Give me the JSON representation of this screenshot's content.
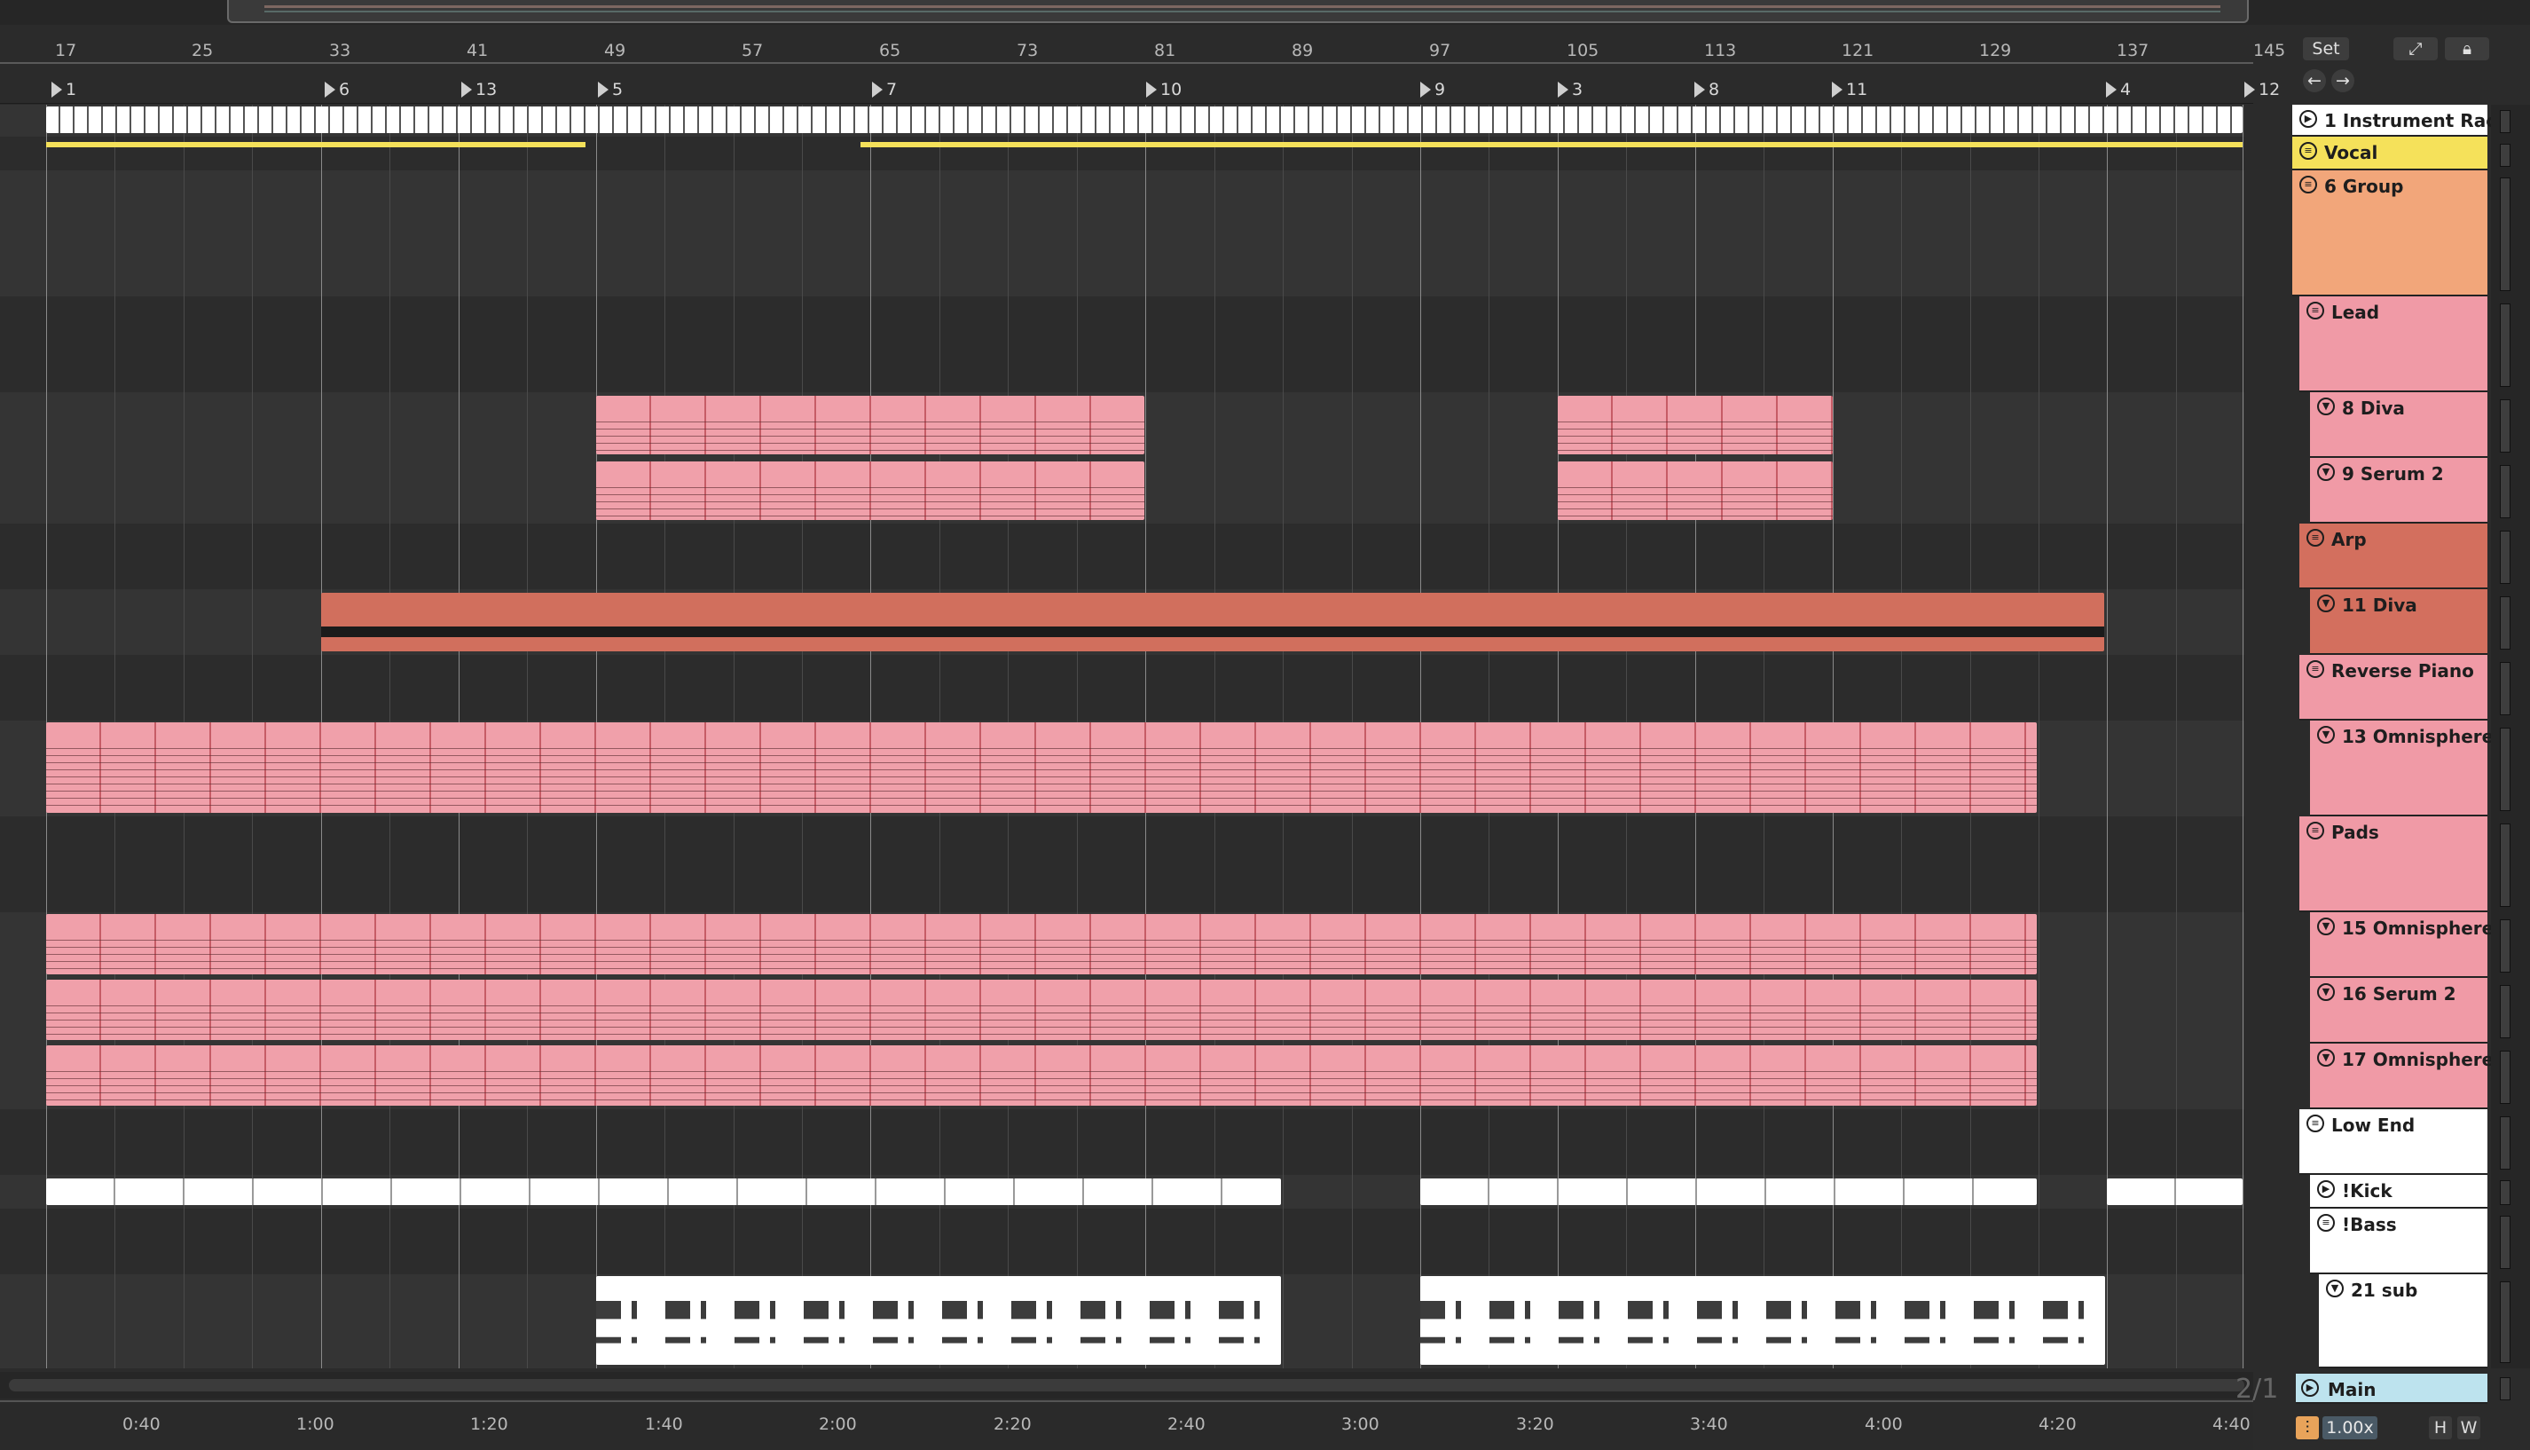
{
  "bar_ruler": [
    "17",
    "25",
    "33",
    "41",
    "49",
    "57",
    "65",
    "73",
    "81",
    "89",
    "97",
    "105",
    "113",
    "121",
    "129",
    "137",
    "145"
  ],
  "locators": [
    "1",
    "6",
    "13",
    "5",
    "7",
    "10",
    "9",
    "3",
    "8",
    "11",
    "4",
    "12"
  ],
  "time_ruler": [
    "0:40",
    "1:00",
    "1:20",
    "1:40",
    "2:00",
    "2:20",
    "2:40",
    "3:00",
    "3:20",
    "3:40",
    "4:00",
    "4:20",
    "4:40"
  ],
  "controls": {
    "set_label": "Set",
    "expand_icon": "expand-icon",
    "lock_icon": "lock-icon",
    "back_icon": "arrow-left-icon",
    "forward_icon": "arrow-right-icon",
    "tempo_multiplier": "1.00x",
    "h_label": "H",
    "w_label": "W",
    "grid_readout": "2/1"
  },
  "tracks": [
    {
      "name": "1 Instrument Rac",
      "color": "#ffffff",
      "icon": "play-icon"
    },
    {
      "name": "Vocal",
      "color": "#f5e15a",
      "icon": "group-icon"
    },
    {
      "name": "6 Group",
      "color": "#f2a67a",
      "icon": "group-icon"
    },
    {
      "name": "Lead",
      "color": "#f09aa6",
      "icon": "group-icon"
    },
    {
      "name": "8 Diva",
      "color": "#f09aa6",
      "icon": "chevron-icon"
    },
    {
      "name": "9 Serum 2",
      "color": "#f09aa6",
      "icon": "chevron-icon"
    },
    {
      "name": "Arp",
      "color": "#d36f5e",
      "icon": "group-icon"
    },
    {
      "name": "11 Diva",
      "color": "#d36f5e",
      "icon": "chevron-icon"
    },
    {
      "name": "Reverse Piano",
      "color": "#f09aa6",
      "icon": "group-icon"
    },
    {
      "name": "13 Omnisphere",
      "color": "#f09aa6",
      "icon": "chevron-icon"
    },
    {
      "name": "Pads",
      "color": "#f09aa6",
      "icon": "group-icon"
    },
    {
      "name": "15 Omnisphere",
      "color": "#f09aa6",
      "icon": "chevron-icon"
    },
    {
      "name": "16 Serum 2",
      "color": "#f09aa6",
      "icon": "chevron-icon"
    },
    {
      "name": "17 Omnisphere",
      "color": "#f09aa6",
      "icon": "chevron-icon"
    },
    {
      "name": "Low End",
      "color": "#ffffff",
      "icon": "group-icon"
    },
    {
      "name": "!Kick",
      "color": "#ffffff",
      "icon": "play-icon"
    },
    {
      "name": "!Bass",
      "color": "#ffffff",
      "icon": "group-icon"
    },
    {
      "name": "21 sub",
      "color": "#ffffff",
      "icon": "chevron-icon"
    },
    {
      "name": "Main",
      "color": "#bde3ee",
      "icon": "play-icon"
    }
  ]
}
